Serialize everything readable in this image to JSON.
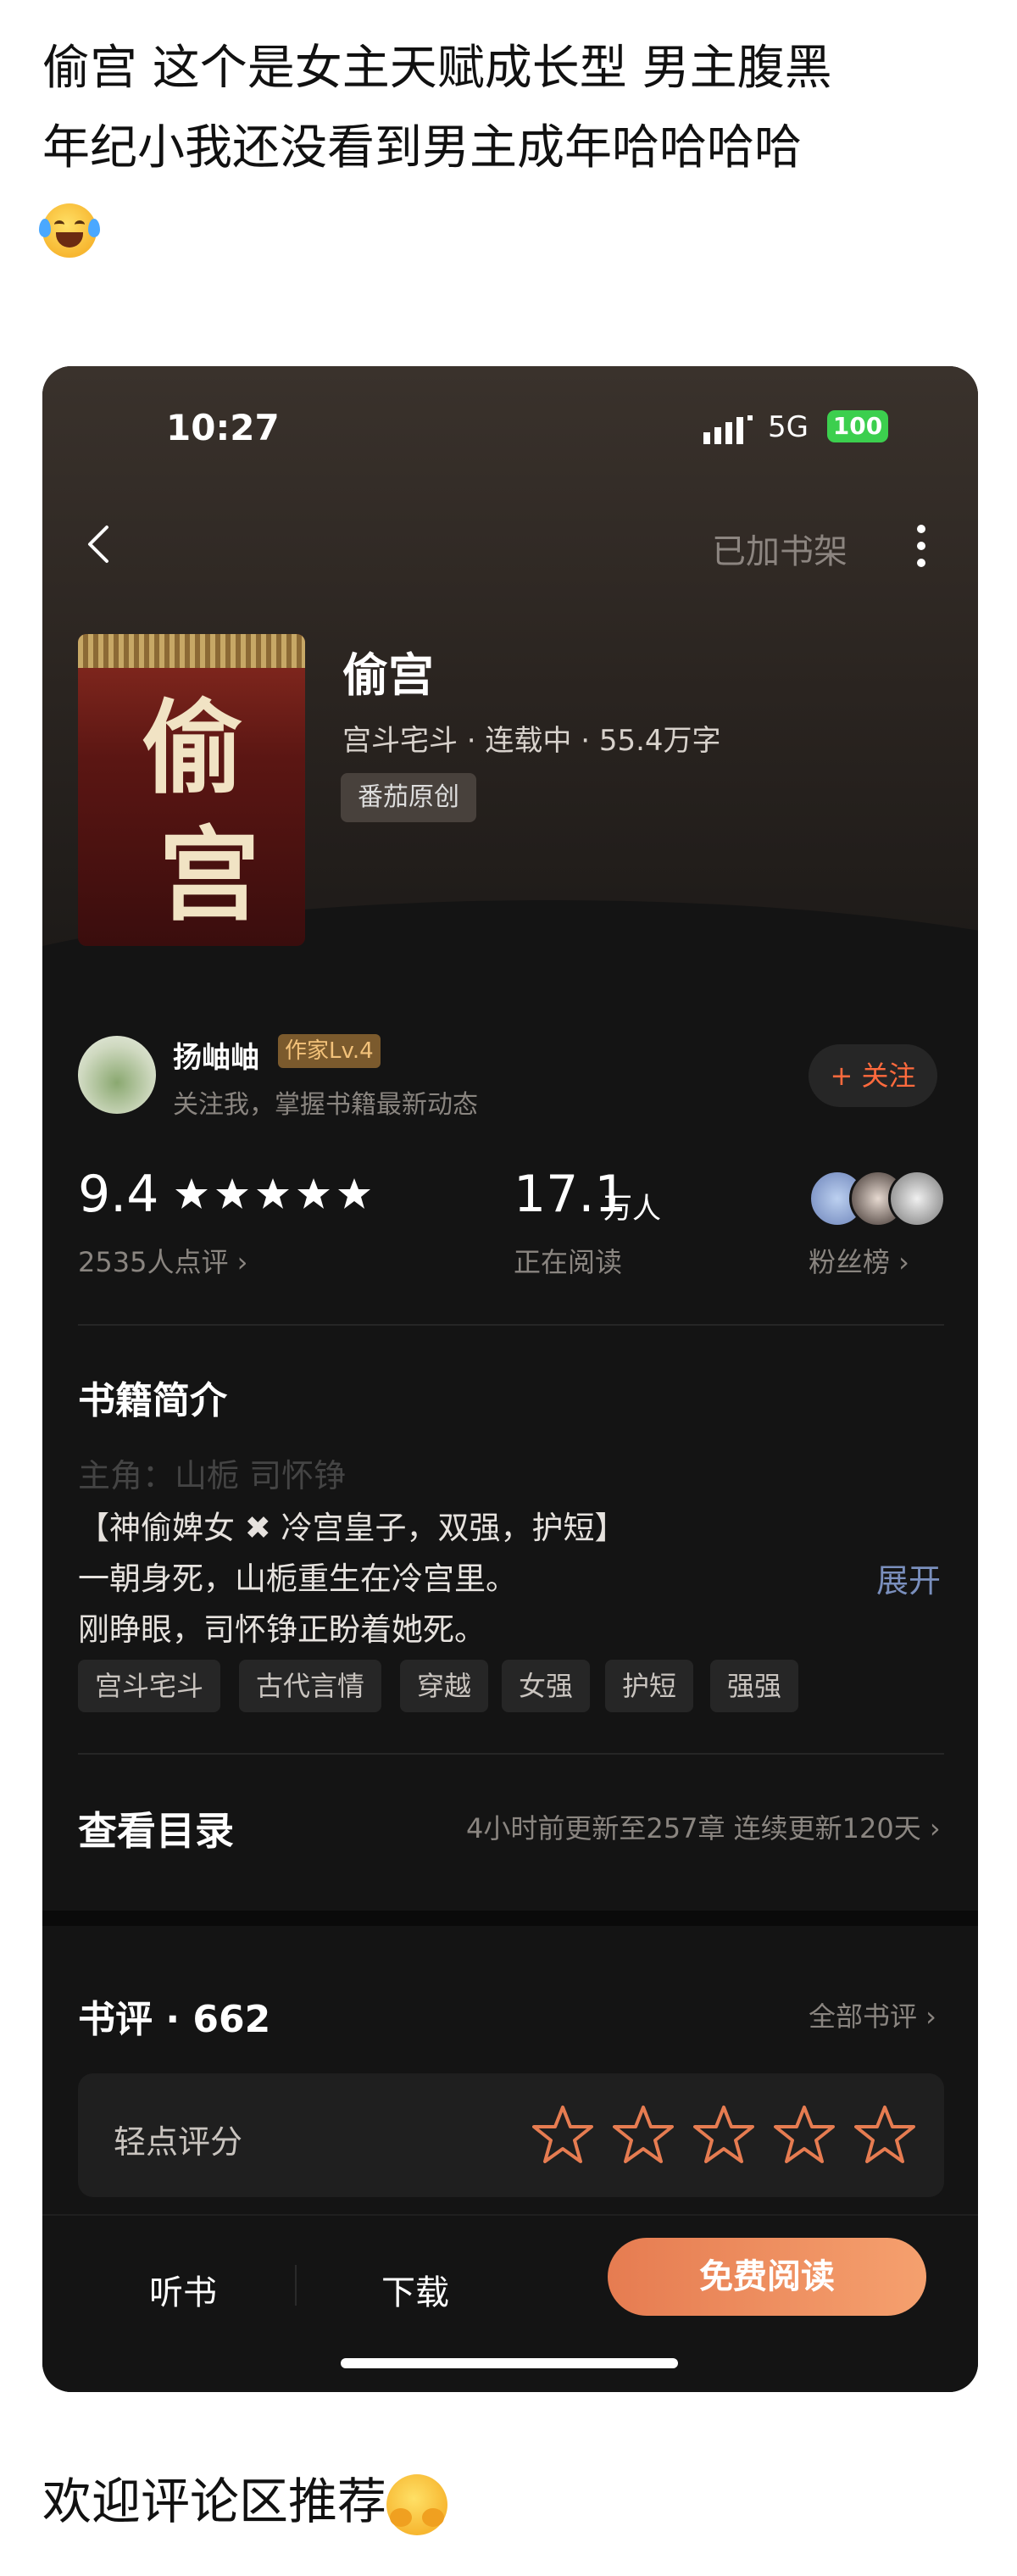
{
  "post": {
    "line1": "偷宫 这个是女主天赋成长型 男主腹黑",
    "line2": "年纪小我还没看到男主成年哈哈哈哈",
    "footer": "欢迎评论区推荐"
  },
  "status_bar": {
    "time": "10:27",
    "network": "5G",
    "battery": "100"
  },
  "nav": {
    "shelf_label": "已加书架"
  },
  "book": {
    "cover_title_1": "偷",
    "cover_title_2": "宫",
    "title": "偷宫",
    "meta": "宫斗宅斗 · 连载中 · 55.4万字",
    "tag": "番茄原创"
  },
  "author": {
    "name": "扬岫岫",
    "level": "作家Lv.4",
    "tip": "关注我，掌握书籍最新动态",
    "follow_label": "+ 关注"
  },
  "stats": {
    "rating": "9.4",
    "rating_count": "2535人点评 ›",
    "readers": "17.1",
    "readers_unit": "万人",
    "readers_label": "正在阅读",
    "fans_label": "粉丝榜 ›",
    "star_count": 5
  },
  "intro": {
    "title": "书籍简介",
    "line0": "主角：山栀 司怀铮",
    "line1": "【神偷婢女 ✖ 冷宫皇子，双强，护短】",
    "line2": "一朝身死，山栀重生在冷宫里。",
    "line3": "刚睁眼，司怀铮正盼着她死。",
    "expand": "展开",
    "tags": [
      "宫斗宅斗",
      "古代言情",
      "穿越",
      "女强",
      "护短",
      "强强"
    ]
  },
  "catalog": {
    "label": "查看目录",
    "info": "4小时前更新至257章 连续更新120天 ›"
  },
  "reviews": {
    "title": "书评 · 662",
    "all_label": "全部书评 ›",
    "quick_label": "轻点评分"
  },
  "bottom": {
    "listen": "听书",
    "download": "下载",
    "read": "免费阅读"
  },
  "colors": {
    "accent": "#e67c51",
    "follow": "#ff6a3d",
    "battery": "#3ccf4e",
    "expand": "#7a8fbd"
  }
}
